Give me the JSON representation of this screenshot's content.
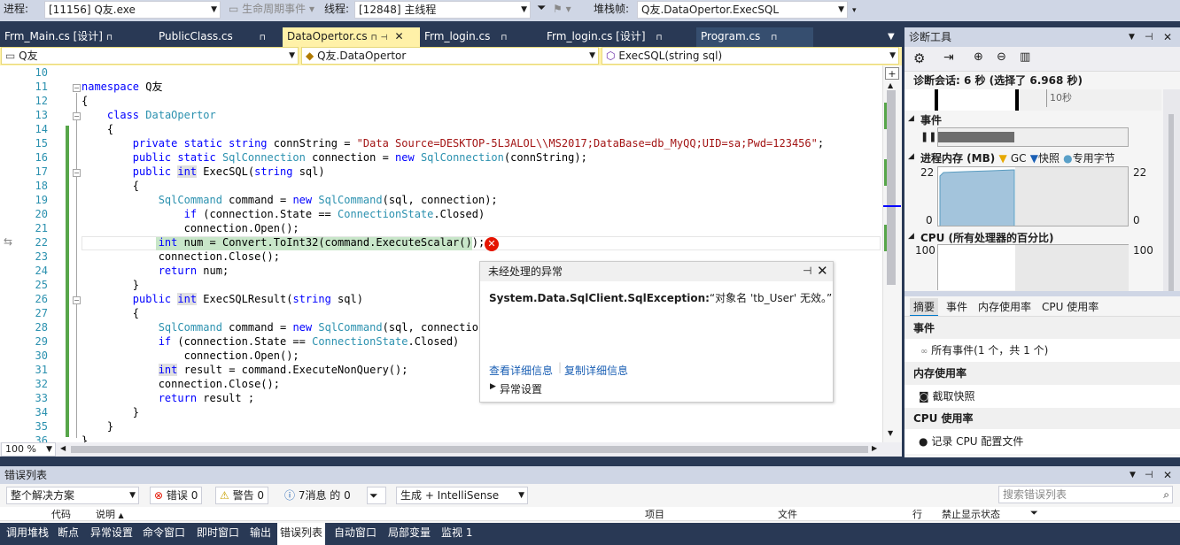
{
  "topbar": {
    "process_label": "进程:",
    "process_value": "[11156] Q友.exe",
    "lifecycle_label": "生命周期事件",
    "thread_label": "线程:",
    "thread_value": "[12848] 主线程",
    "stackframe_label": "堆栈帧:",
    "stackframe_value": "Q友.DataOpertor.ExecSQL"
  },
  "tabs": [
    {
      "label": "Frm_Main.cs [设计]"
    },
    {
      "label": "PublicClass.cs"
    },
    {
      "label": "DataOpertor.cs"
    },
    {
      "label": "Frm_login.cs"
    },
    {
      "label": "Frm_login.cs [设计]"
    },
    {
      "label": "Program.cs"
    }
  ],
  "navbar": {
    "project": "Q友",
    "class": "Q友.DataOpertor",
    "member": "ExecSQL(string sql)"
  },
  "editor": {
    "line_numbers": [
      "10",
      "11",
      "12",
      "13",
      "14",
      "15",
      "16",
      "17",
      "18",
      "19",
      "20",
      "21",
      "22",
      "23",
      "24",
      "25",
      "26",
      "27",
      "28",
      "29",
      "30",
      "31",
      "32",
      "33",
      "34",
      "35",
      "36"
    ],
    "zoom": "100 %"
  },
  "exception": {
    "title": "未经处理的异常",
    "type": "System.Data.SqlClient.SqlException:",
    "message": "“对象名 'tb_User' 无效。”",
    "link_details": "查看详细信息",
    "link_copy": "复制详细信息",
    "settings": "异常设置"
  },
  "diag": {
    "title": "诊断工具",
    "session": "诊断会话: 6 秒 (选择了 6.968 秒)",
    "tick_label": "10秒",
    "events_header": "事件",
    "memory_header": "进程内存 (MB)",
    "legend_gc": "GC",
    "legend_snapshot": "快照",
    "legend_private": "专用字节",
    "mem_max": "22",
    "mem_min": "0",
    "cpu_header": "CPU (所有处理器的百分比)",
    "cpu_max": "100",
    "subtabs": [
      "摘要",
      "事件",
      "内存使用率",
      "CPU 使用率"
    ],
    "sec_events": "事件",
    "all_events": "所有事件(1 个，共 1 个)",
    "sec_memory": "内存使用率",
    "take_snapshot": "截取快照",
    "sec_cpu": "CPU 使用率",
    "record_cpu": "记录 CPU 配置文件",
    "colors": {
      "accent": "#007acc",
      "chart_fill": "#a3c4dc",
      "gc": "#e6a800",
      "snapshot": "#1a5fb4",
      "private": "#5aa0c8"
    }
  },
  "errorlist": {
    "title": "错误列表",
    "scope": "整个解决方案",
    "errors": "错误 0",
    "warnings": "警告 0",
    "messages": "7消息 的 0",
    "build": "生成 + IntelliSense",
    "search_placeholder": "搜索错误列表",
    "columns": {
      "code": "代码",
      "description": "说明",
      "project": "项目",
      "file": "文件",
      "line": "行",
      "suppression": "禁止显示状态"
    }
  },
  "bottomtabs": [
    "调用堆栈",
    "断点",
    "异常设置",
    "命令窗口",
    "即时窗口",
    "输出",
    "错误列表",
    "自动窗口",
    "局部变量",
    "监视 1"
  ]
}
